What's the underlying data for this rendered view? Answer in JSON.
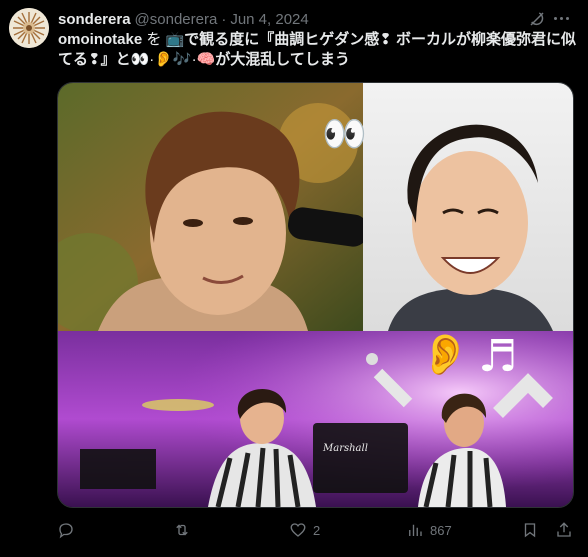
{
  "post": {
    "author": {
      "name": "sonderera",
      "handle": "@sonderera",
      "separator": "·",
      "date": "Jun 4, 2024"
    },
    "text": {
      "p1": "omoinotake",
      "p2": " を ",
      "p3": "📺",
      "p4": "で観る度に『曲調ヒゲダン感❢ ボーカルが",
      "p5": "柳楽優弥君に似てる❢』と",
      "p6": "👀·👂🎶·🧠",
      "p7": "が大混乱してしまう"
    },
    "media": {
      "overlay_eyes": "👀",
      "overlay_ear": "👂",
      "overlay_note": "♬",
      "amp_brand": "Marshall"
    },
    "actions": {
      "reply": {
        "icon": "reply-icon",
        "count": ""
      },
      "repost": {
        "icon": "repost-icon",
        "count": ""
      },
      "like": {
        "icon": "heart-icon",
        "count": "2"
      },
      "views": {
        "icon": "views-icon",
        "count": "867"
      },
      "bookmark": {
        "icon": "bookmark-icon"
      },
      "share": {
        "icon": "share-icon"
      }
    }
  }
}
